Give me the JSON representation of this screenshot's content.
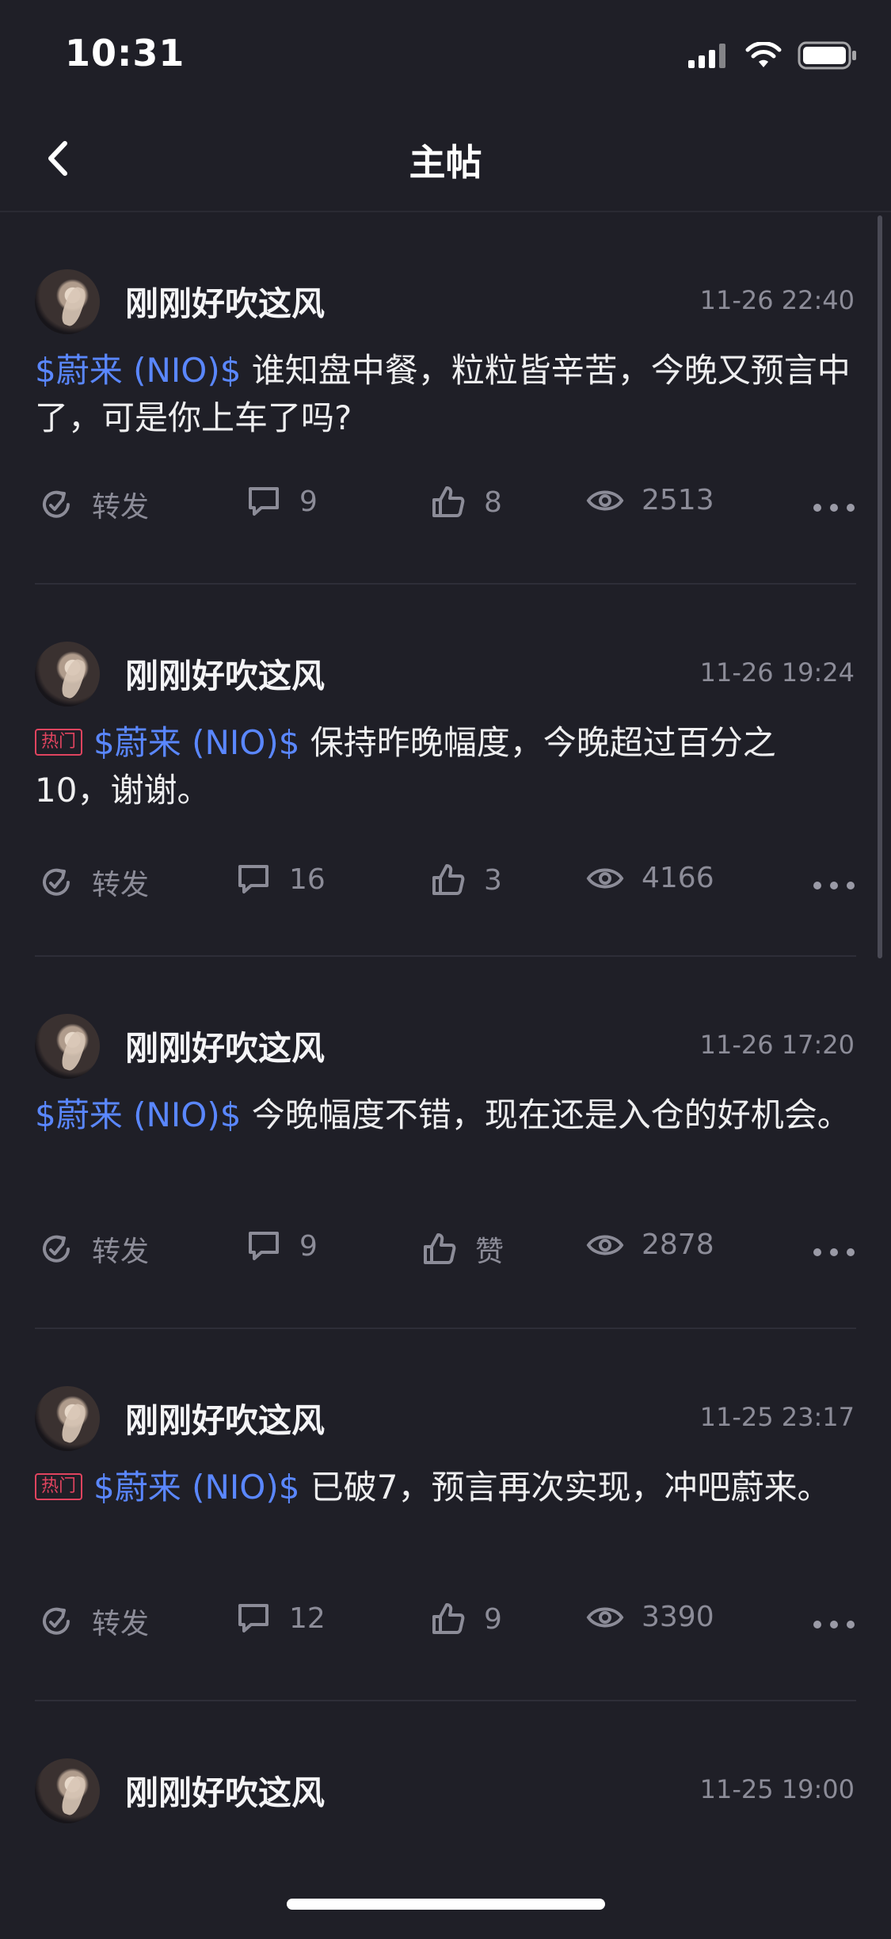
{
  "status_bar": {
    "time": "10:31"
  },
  "nav": {
    "title": "主帖"
  },
  "posts": [
    {
      "username": "刚刚好吹这风",
      "time": "11-26 22:40",
      "hot": false,
      "stock_tag": "$蔚来 (NIO)$",
      "text": " 谁知盘中餐，粒粒皆辛苦，今晚又预言中了，可是你上车了吗?",
      "repost_label": "转发",
      "comments": "9",
      "likes": "8",
      "views": "2513"
    },
    {
      "username": "刚刚好吹这风",
      "time": "11-26 19:24",
      "hot": true,
      "hot_label": "热门",
      "stock_tag": "$蔚来 (NIO)$",
      "text": " 保持昨晚幅度，今晚超过百分之10，谢谢。",
      "repost_label": "转发",
      "comments": "16",
      "likes": "3",
      "views": "4166"
    },
    {
      "username": "刚刚好吹这风",
      "time": "11-26 17:20",
      "hot": false,
      "stock_tag": "$蔚来 (NIO)$",
      "text": " 今晚幅度不错，现在还是入仓的好机会。",
      "repost_label": "转发",
      "comments": "9",
      "likes": "赞",
      "views": "2878"
    },
    {
      "username": "刚刚好吹这风",
      "time": "11-25 23:17",
      "hot": true,
      "hot_label": "热门",
      "stock_tag": "$蔚来 (NIO)$",
      "text": " 已破7，预言再次实现，冲吧蔚来。",
      "repost_label": "转发",
      "comments": "12",
      "likes": "9",
      "views": "3390"
    },
    {
      "username": "刚刚好吹这风",
      "time": "11-25 19:00"
    }
  ],
  "icons": {
    "back": "chevron-left-icon",
    "repost": "repost-icon",
    "comment": "comment-icon",
    "like": "thumbs-up-icon",
    "views": "eye-icon",
    "more": "more-dots-icon"
  },
  "colors": {
    "background": "#1f1f27",
    "stock_tag": "#5a87ff",
    "hot_badge": "#e0445f",
    "muted_text": "#8c8c98"
  }
}
